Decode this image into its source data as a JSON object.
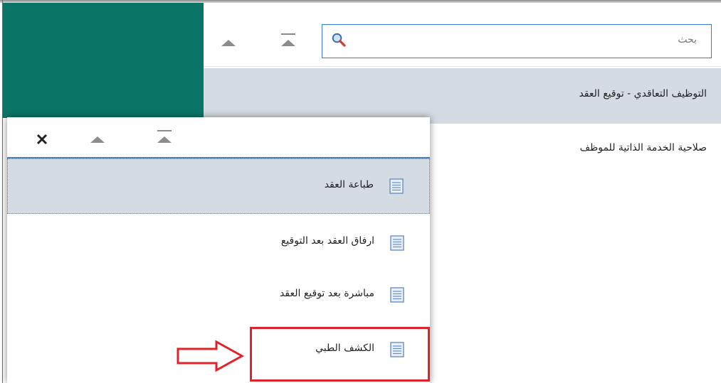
{
  "search": {
    "placeholder": "بحث"
  },
  "main_list": {
    "items": [
      {
        "label": "التوظيف التعاقدي - توقيع العقد",
        "selected": true
      },
      {
        "label": "صلاحية الخدمة الذاتية للموظف",
        "selected": false
      }
    ]
  },
  "popup": {
    "items": [
      {
        "label": "طباعة العقد",
        "selected": true
      },
      {
        "label": "ارفاق العقد بعد التوقيع",
        "selected": false
      },
      {
        "label": "مباشرة بعد توقيع العقد",
        "selected": false
      },
      {
        "label": "الكشف الطبي",
        "selected": false,
        "highlighted": true
      }
    ]
  },
  "colors": {
    "teal": "#0a7566",
    "selection": "#d4dbe2",
    "highlight": "#e0232b",
    "accent_blue": "#4a7fc1"
  },
  "icons": {
    "search": "magnifier-icon",
    "top": "move-to-top-icon",
    "up": "move-up-icon",
    "close": "close-icon",
    "item": "document-icon",
    "pointer": "outline-arrow-right-icon"
  }
}
